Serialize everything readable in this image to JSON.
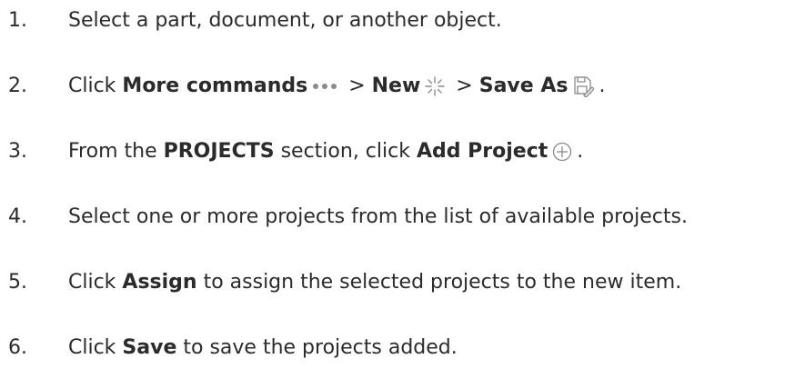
{
  "steps": [
    {
      "number": "1.",
      "parts": {
        "t1": "Select a part, document, or another object."
      }
    },
    {
      "number": "2.",
      "parts": {
        "t1": "Click ",
        "b1": "More commands",
        "t2": " > ",
        "b2": "New",
        "t3": " > ",
        "b3": "Save As",
        "t4": "."
      },
      "icons": [
        "more-commands-icon",
        "new-sparkle-icon",
        "save-as-icon"
      ]
    },
    {
      "number": "3.",
      "parts": {
        "t1": "From the ",
        "b1": "PROJECTS",
        "t2": " section, click ",
        "b2": "Add Project",
        "t3": "."
      },
      "icons": [
        "add-circle-icon"
      ]
    },
    {
      "number": "4.",
      "parts": {
        "t1": "Select one or more projects from the list of available projects."
      }
    },
    {
      "number": "5.",
      "parts": {
        "t1": "Click ",
        "b1": "Assign",
        "t2": " to assign the selected projects to the new item."
      }
    },
    {
      "number": "6.",
      "parts": {
        "t1": "Click ",
        "b1": "Save",
        "t2": " to save the projects added."
      }
    }
  ],
  "colors": {
    "text": "#2b2b2b",
    "icon": "#8a8a8a",
    "background": "#ffffff"
  }
}
